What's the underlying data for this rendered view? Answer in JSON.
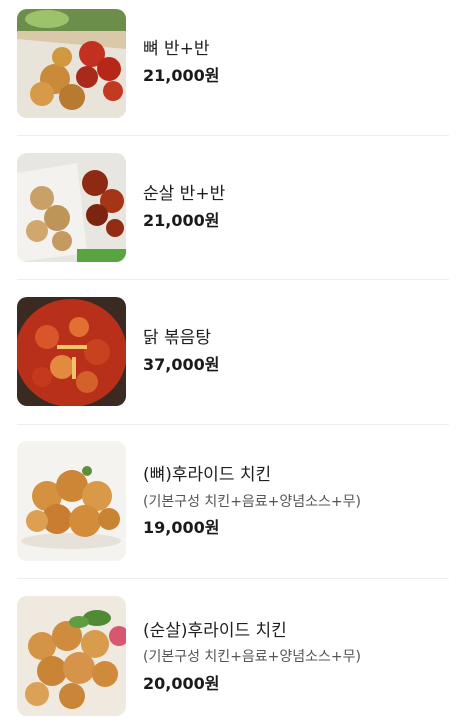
{
  "menu": {
    "items": [
      {
        "name": "뼈 반+반",
        "price": "21,000원",
        "image": "half-half-bone-chicken-photo"
      },
      {
        "name": "순살 반+반",
        "price": "21,000원",
        "image": "half-half-boneless-chicken-photo"
      },
      {
        "name": "닭 볶음탕",
        "price": "37,000원",
        "image": "spicy-braised-chicken-photo"
      },
      {
        "name": "(뼈)후라이드 치킨",
        "description": "(기본구성 치킨+음료+양념소스+무)",
        "price": "19,000원",
        "image": "fried-chicken-bone-photo"
      },
      {
        "name": "(순살)후라이드 치킨",
        "description": "(기본구성 치킨+음료+양념소스+무)",
        "price": "20,000원",
        "image": "fried-chicken-boneless-photo"
      }
    ]
  }
}
